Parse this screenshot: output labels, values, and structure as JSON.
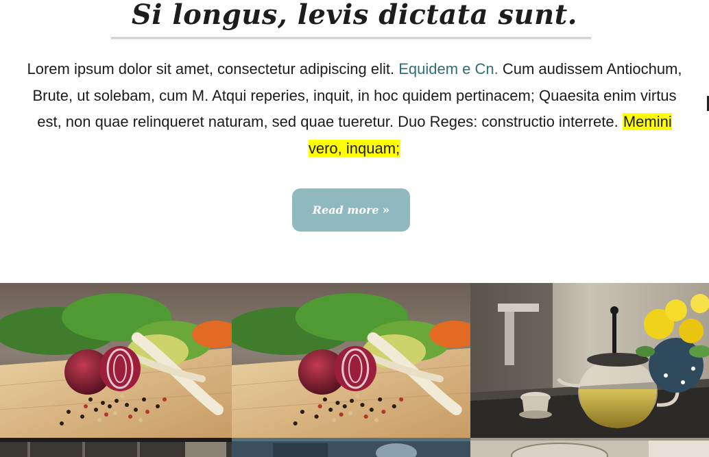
{
  "article": {
    "title": "Si longus, levis dictata sunt.",
    "text_part1": "Lorem ipsum dolor sit amet, consectetur adipiscing elit. ",
    "link_label": "Equidem e Cn.",
    "text_part2": " Cum audissem Antiochum, Brute, ut solebam, cum M. Atqui reperies, inquit, in hoc quidem pertinacem; Quaesita enim virtus est, non quae relinqueret naturam, sed quae tueretur. Duo Reges: constructio interrete. ",
    "highlight": "Memini vero, inquam;",
    "read_more_label": "Read more",
    "read_more_icon": "double-chevron-right-icon"
  },
  "colors": {
    "link": "#2e6e75",
    "highlight": "#ffff00",
    "button": "#8fb8bf",
    "button_text": "#ffffff"
  },
  "gallery": {
    "items": [
      {
        "subject": "vegetables on cutting board"
      },
      {
        "subject": "vegetables on cutting board"
      },
      {
        "subject": "glass teapot with yellow flowers"
      },
      {
        "subject": "dark interior"
      },
      {
        "subject": "blue-gray scene"
      },
      {
        "subject": "light interior"
      }
    ]
  }
}
